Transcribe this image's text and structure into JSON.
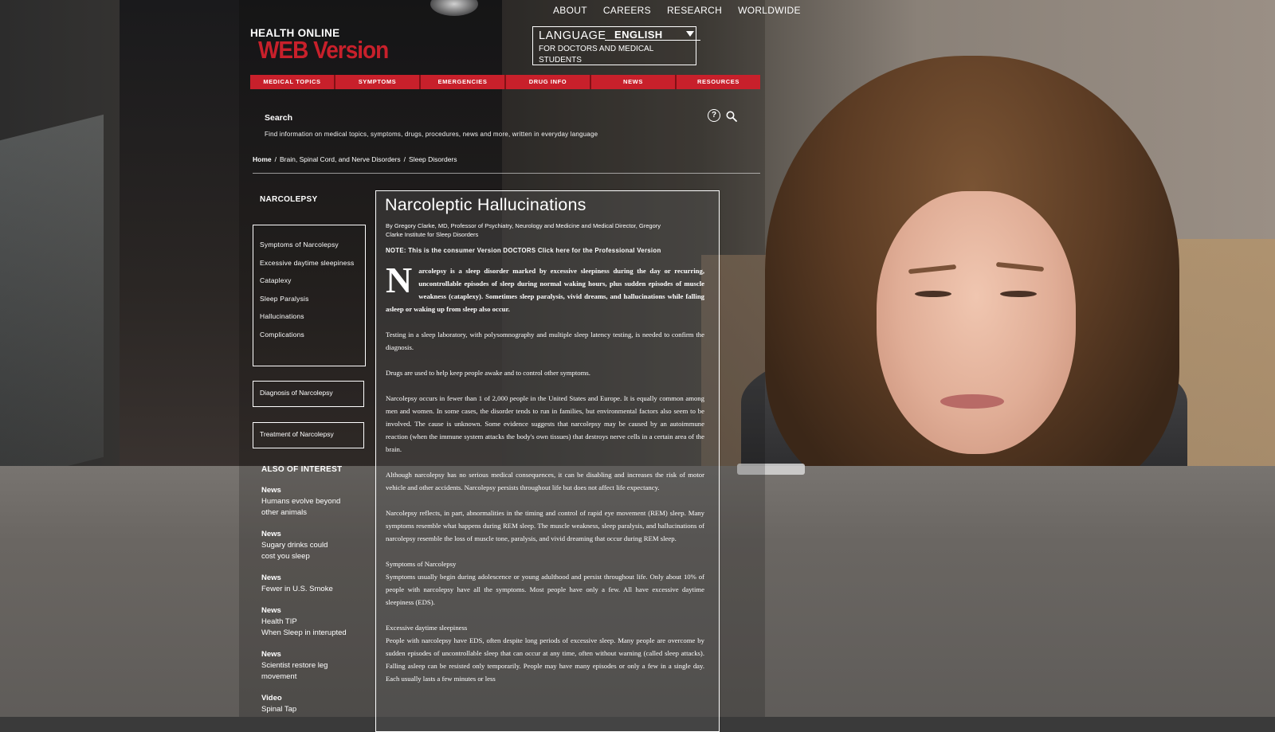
{
  "top_nav": [
    "ABOUT",
    "CAREERS",
    "RESEARCH",
    "WORLDWIDE"
  ],
  "logo": {
    "line1": "HEALTH ONLINE",
    "line2": "WEB Version"
  },
  "language": {
    "label": "LANGUAGE",
    "selected": "ENGLISH",
    "subtitle": "FOR DOCTORS AND MEDICAL STUDENTS"
  },
  "main_nav": [
    "MEDICAL TOPICS",
    "SYMPTOMS",
    "EMERGENCIES",
    "DRUG INFO",
    "NEWS",
    "RESOURCES"
  ],
  "search": {
    "label": "Search",
    "description": "Find information on medical topics, symptoms, drugs, procedures, news and more, written in everyday language"
  },
  "breadcrumb": [
    "Home",
    "/",
    "Brain, Spinal Cord, and Nerve Disorders",
    "/",
    "Sleep Disorders"
  ],
  "sidebar": {
    "title": "NARCOLEPSY",
    "links": [
      "Symptoms of Narcolepsy",
      "Excessive daytime sleepiness",
      "Cataplexy",
      "Sleep Paralysis",
      "Hallucinations",
      "Complications"
    ],
    "diagnosis_label": "Diagnosis of Narcolepsy",
    "treatment_label": "Treatment of Narcolepsy",
    "also_title": "ALSO OF INTEREST",
    "news": [
      {
        "category": "News",
        "lines": [
          "Humans evolve beyond",
          "other animals"
        ]
      },
      {
        "category": "News",
        "lines": [
          "Sugary drinks could",
          "cost you sleep"
        ]
      },
      {
        "category": "News",
        "lines": [
          "Fewer in U.S. Smoke"
        ]
      },
      {
        "category": "News",
        "lines": [
          "Health TIP",
          "When Sleep in interupted"
        ]
      },
      {
        "category": "News",
        "lines": [
          "Scientist restore leg",
          "movement"
        ]
      },
      {
        "category": "Video",
        "lines": [
          "Spinal Tap"
        ]
      }
    ]
  },
  "article": {
    "title": "Narcoleptic Hallucinations",
    "byline": "By Gregory Clarke, MD, Professor of Psychiatry, Neurology and Medicine and Medical Director, Gregory Clarke Institute for Sleep Disorders",
    "note": "NOTE: This is the consumer Version DOCTORS Click here for the Professional Version",
    "dropcap": "N",
    "lead": "arcolepsy is a sleep disorder marked by excessive sleepiness during the day or recurring, uncontrollable episodes of sleep during normal waking hours, plus sudden episodes of muscle weakness (cataplexy). Sometimes sleep paralysis, vivid dreams, and hallucinations while falling asleep or waking up from sleep also occur.",
    "p1": "Testing in a sleep laboratory, with polysomnography and multiple sleep latency testing, is needed to confirm the diagnosis.",
    "p2": "Drugs are used to help keep people awake and to control other symptoms.",
    "p3": "Narcolepsy occurs in fewer than 1 of 2,000 people in the United States and Europe. It is equally common among men and women. In some cases, the disorder tends to run in families, but environmental factors also seem to be involved. The cause is unknown. Some evidence suggests that narcolepsy may be caused by an autoimmune reaction (when the immune system attacks the body's own tissues) that destroys nerve cells in a certain area of the brain.",
    "p4": "Although narcolepsy has no serious medical consequences, it can be disabling and increases the risk of motor vehicle and other accidents. Narcolepsy persists throughout life but does not affect life expectancy.",
    "p5": "Narcolepsy reflects, in part, abnormalities in the timing and control of rapid eye movement (REM) sleep. Many symptoms resemble what happens during REM sleep. The muscle weakness, sleep paralysis, and hallucinations of narcolepsy resemble the loss of muscle tone, paralysis, and vivid dreaming that occur during REM sleep.",
    "h1": "Symptoms of Narcolepsy",
    "p6": "Symptoms usually begin during adolescence or young adulthood and persist throughout life. Only about 10% of people with narcolepsy have all the symptoms. Most people have only a few. All have excessive daytime sleepiness (EDS).",
    "h2": "Excessive daytime sleepiness",
    "p7": "People with narcolepsy have EDS, often despite long periods of excessive sleep. Many people are overcome by sudden episodes of uncontrollable sleep that can occur at any time, often without warning (called sleep attacks). Falling asleep can be resisted only temporarily. People may have many episodes or only a few in a single day. Each usually lasts a few minutes or less"
  },
  "colors": {
    "accent_red": "#c8202b",
    "overlay_text": "#ffffff"
  }
}
